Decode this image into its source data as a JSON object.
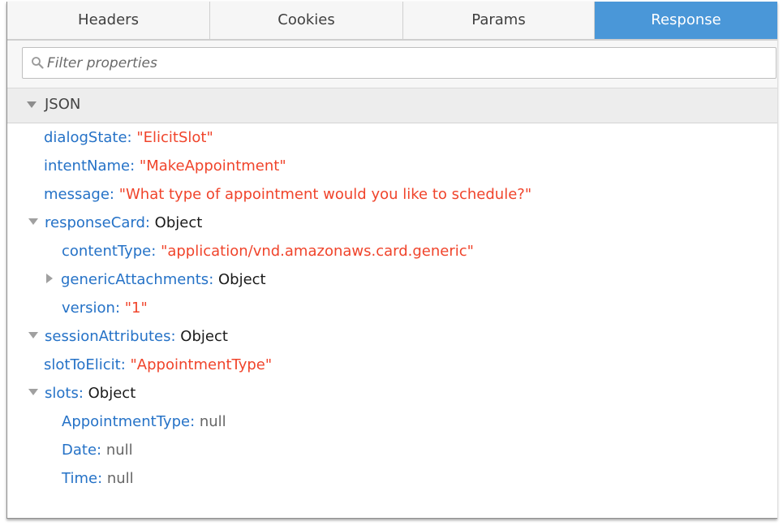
{
  "tabs": [
    {
      "label": "Headers",
      "active": false
    },
    {
      "label": "Cookies",
      "active": false
    },
    {
      "label": "Params",
      "active": false
    },
    {
      "label": "Response",
      "active": true
    }
  ],
  "filter": {
    "placeholder": "Filter properties",
    "value": ""
  },
  "section": {
    "label": "JSON",
    "expanded": true
  },
  "rows": [
    {
      "key": "dialogState",
      "value": "\"ElicitSlot\"",
      "type": "string",
      "level": 0,
      "toggle": "none"
    },
    {
      "key": "intentName",
      "value": "\"MakeAppointment\"",
      "type": "string",
      "level": 0,
      "toggle": "none"
    },
    {
      "key": "message",
      "value": "\"What type of appointment would you like to schedule?\"",
      "type": "string",
      "level": 0,
      "toggle": "none"
    },
    {
      "key": "responseCard",
      "value": "Object",
      "type": "object",
      "level": 0,
      "toggle": "expanded"
    },
    {
      "key": "contentType",
      "value": "\"application/vnd.amazonaws.card.generic\"",
      "type": "string",
      "level": 1,
      "toggle": "none"
    },
    {
      "key": "genericAttachments",
      "value": "Object",
      "type": "object",
      "level": 1,
      "toggle": "collapsed"
    },
    {
      "key": "version",
      "value": "\"1\"",
      "type": "string",
      "level": 1,
      "toggle": "none"
    },
    {
      "key": "sessionAttributes",
      "value": "Object",
      "type": "object",
      "level": 0,
      "toggle": "expanded"
    },
    {
      "key": "slotToElicit",
      "value": "\"AppointmentType\"",
      "type": "string",
      "level": 0,
      "toggle": "none"
    },
    {
      "key": "slots",
      "value": "Object",
      "type": "object",
      "level": 0,
      "toggle": "expanded"
    },
    {
      "key": "AppointmentType",
      "value": "null",
      "type": "null",
      "level": 1,
      "toggle": "none"
    },
    {
      "key": "Date",
      "value": "null",
      "type": "null",
      "level": 1,
      "toggle": "none"
    },
    {
      "key": "Time",
      "value": "null",
      "type": "null",
      "level": 1,
      "toggle": "none"
    }
  ],
  "colors": {
    "accent": "#4a97d8",
    "key": "#2572c7",
    "string": "#f0442b",
    "object": "#1a1a1a",
    "null": "#666666"
  },
  "icons": {
    "filter": "search-icon",
    "section": "triangle-down-icon"
  }
}
